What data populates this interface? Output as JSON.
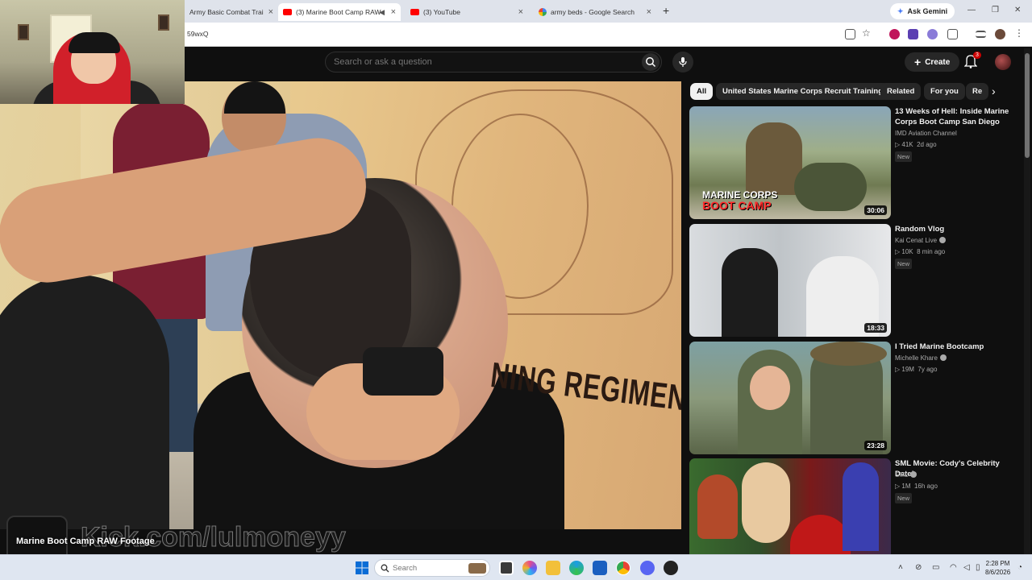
{
  "browser": {
    "tabs": [
      {
        "title": "Army Basic Combat Trai",
        "active": false
      },
      {
        "title": "(3) Marine Boot Camp RAW",
        "active": true
      },
      {
        "title": "(3) YouTube",
        "active": false
      },
      {
        "title": "army beds - Google Search",
        "active": false
      }
    ],
    "gemini_label": "Ask Gemini",
    "url_fragment": "59wxQ"
  },
  "youtube": {
    "search_placeholder": "Search or ask a question",
    "create_label": "Create",
    "notification_count": "3",
    "chips": [
      "All",
      "United States Marine Corps Recruit Training",
      "Related",
      "For you",
      "Re"
    ],
    "recommendations": [
      {
        "title": "13 Weeks of Hell: Inside Marine Corps Boot Camp San Diego",
        "channel": "IMD Aviation Channel",
        "verified": false,
        "views": "41K",
        "age": "2d ago",
        "badge": "New",
        "duration": "30:06",
        "thumb_caption_line1": "MARINE CORPS",
        "thumb_caption_line2": "BOOT CAMP"
      },
      {
        "title": "Random Vlog",
        "channel": "Kai Cenat Live",
        "verified": true,
        "views": "10K",
        "age": "8 min ago",
        "badge": "New",
        "duration": "18:33"
      },
      {
        "title": "I Tried Marine Bootcamp",
        "channel": "Michelle Khare",
        "verified": true,
        "views": "19M",
        "age": "7y ago",
        "badge": "",
        "duration": "23:28"
      },
      {
        "title": "SML Movie: Cody's Celebrity Date!",
        "channel": "SML",
        "verified": true,
        "views": "1M",
        "age": "16h ago",
        "badge": "New",
        "duration": ""
      }
    ]
  },
  "video": {
    "wall_text": "NING REGIMENT"
  },
  "stream_overlay": {
    "kick_text": "Kick.com/lulmoneyy",
    "mini_title": "Marine Boot Camp RAW Footage"
  },
  "taskbar": {
    "search_placeholder": "Search",
    "time": "2:28 PM",
    "date": "8/6/2026"
  }
}
